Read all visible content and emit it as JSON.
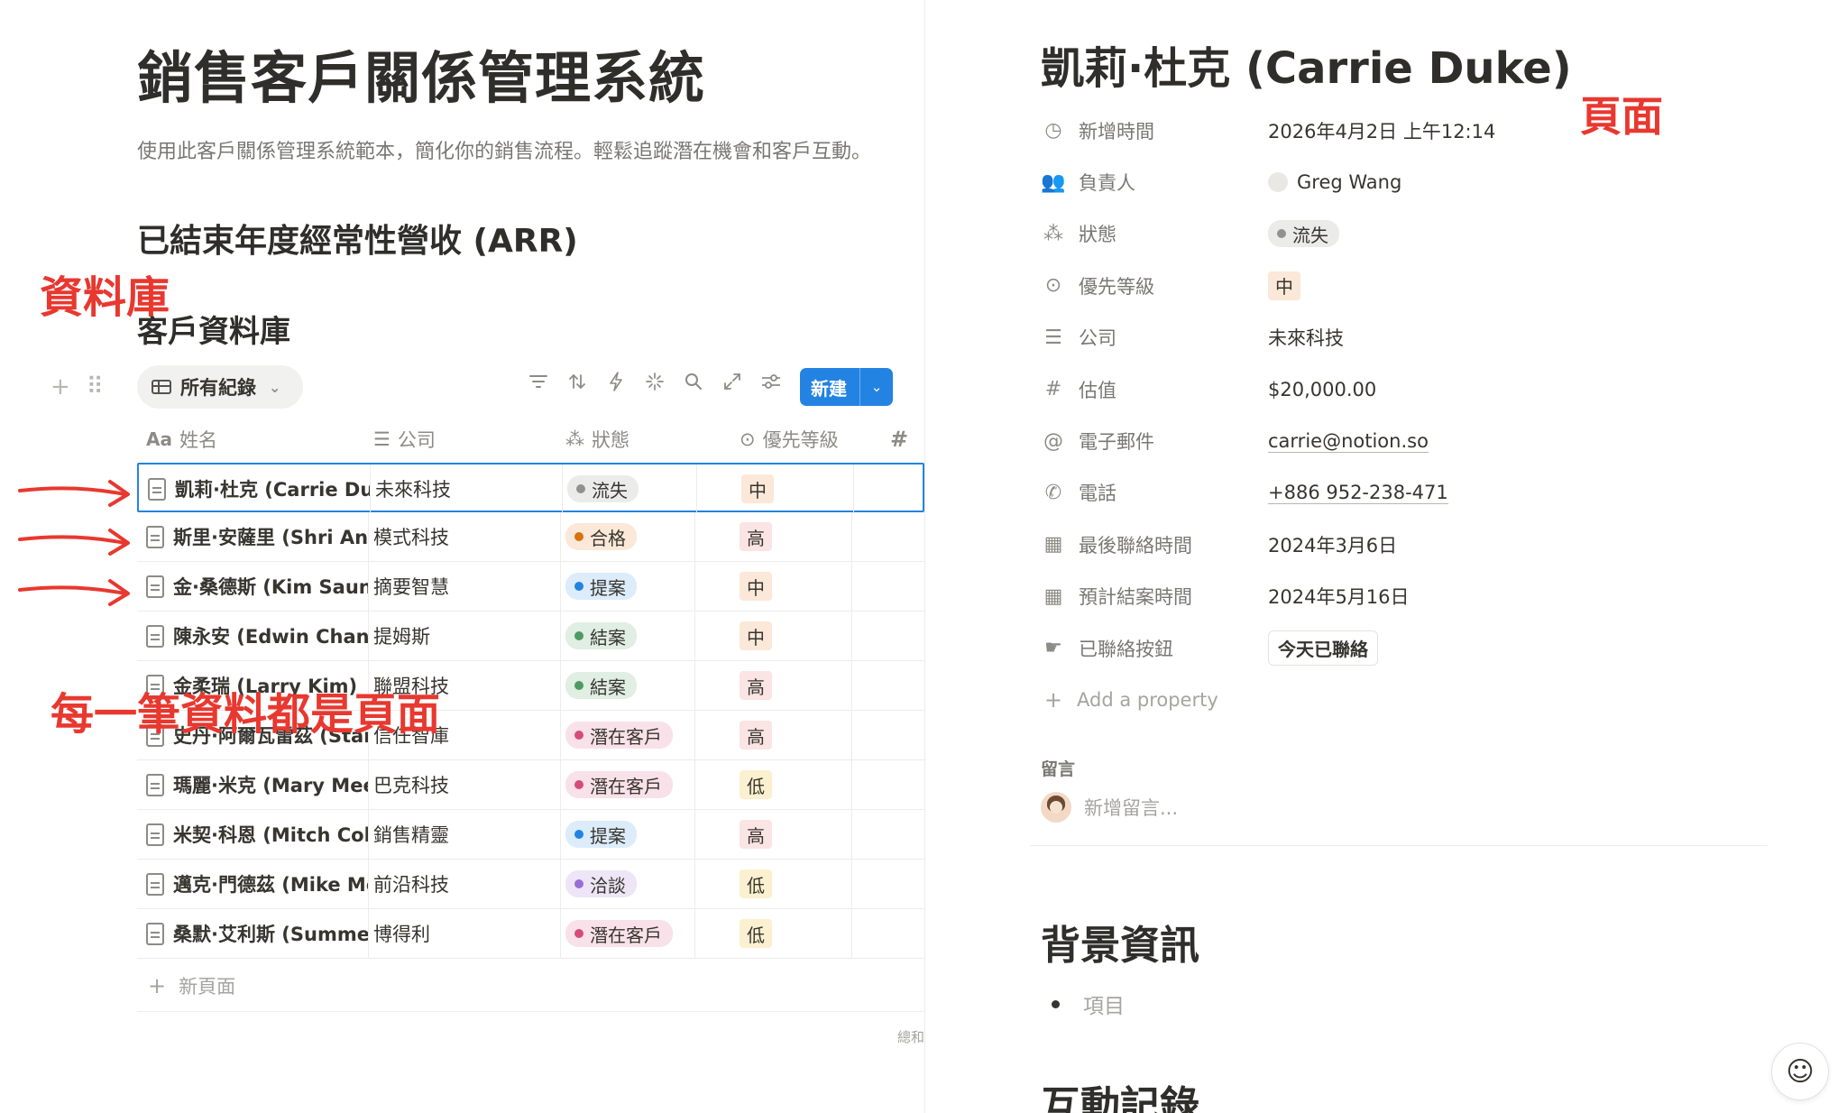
{
  "left": {
    "title": "銷售客戶關係管理系統",
    "description": "使用此客戶關係管理系統範本，簡化你的銷售流程。輕鬆追蹤潛在機會和客戶互動。",
    "heading_arr": "已結束年度經常性營收 (ARR)",
    "heading_db": "客戶資料庫",
    "view_label": "所有紀錄",
    "new_button": "新建",
    "columns": {
      "name": "姓名",
      "company": "公司",
      "status": "狀態",
      "priority": "優先等級"
    },
    "rows": [
      {
        "name": "凱莉·杜克 (Carrie Duke)",
        "company": "未來科技",
        "status": "流失",
        "priority": "中"
      },
      {
        "name": "斯里·安薩里 (Shri Ansari)",
        "company": "模式科技",
        "status": "合格",
        "priority": "高"
      },
      {
        "name": "金·桑德斯 (Kim Saunders)",
        "company": "摘要智慧",
        "status": "提案",
        "priority": "中"
      },
      {
        "name": "陳永安 (Edwin Chan)",
        "company": "提姆斯",
        "status": "結案",
        "priority": "中"
      },
      {
        "name": "金柔瑞 (Larry Kim)",
        "company": "聯盟科技",
        "status": "結案",
        "priority": "高"
      },
      {
        "name": "史丹·阿爾瓦雷茲 (Stan Alvarez)",
        "company": "信任智庫",
        "status": "潛在客戶",
        "priority": "高"
      },
      {
        "name": "瑪麗·米克 (Mary Meeker)",
        "company": "巴克科技",
        "status": "潛在客戶",
        "priority": "低"
      },
      {
        "name": "米契·科恩 (Mitch Cohen)",
        "company": "銷售精靈",
        "status": "提案",
        "priority": "高"
      },
      {
        "name": "邁克·門德茲 (Mike Mendez)",
        "company": "前沿科技",
        "status": "洽談",
        "priority": "低"
      },
      {
        "name": "桑默·艾利斯 (Summer Ellis)",
        "company": "博得利",
        "status": "潛在客戶",
        "priority": "低"
      }
    ],
    "new_page": "新頁面",
    "sum_label": "總和"
  },
  "status_colors": {
    "流失": {
      "bg": "#ebebea",
      "dot": "#91918e",
      "fg": "#37352f"
    },
    "合格": {
      "bg": "#fbe8d8",
      "dot": "#d9730d",
      "fg": "#37352f"
    },
    "提案": {
      "bg": "#dcecfa",
      "dot": "#2383e2",
      "fg": "#37352f"
    },
    "結案": {
      "bg": "#e0eee3",
      "dot": "#4f9a63",
      "fg": "#37352f"
    },
    "潛在客戶": {
      "bg": "#f9e1e9",
      "dot": "#d44c7a",
      "fg": "#37352f"
    },
    "洽談": {
      "bg": "#eee5f6",
      "dot": "#9a6dd7",
      "fg": "#37352f"
    }
  },
  "priority_colors": {
    "高": {
      "bg": "#fbe4e4",
      "fg": "#37352f"
    },
    "中": {
      "bg": "#fbe8d8",
      "fg": "#37352f"
    },
    "低": {
      "bg": "#fbf0cf",
      "fg": "#37352f"
    }
  },
  "annotations": {
    "database": "資料庫",
    "each_row": "每一筆資料都是頁面",
    "page": "頁面"
  },
  "right": {
    "title": "凱莉·杜克 (Carrie Duke)",
    "properties": [
      {
        "icon": "clock-icon",
        "key": "新增時間",
        "value": "2026年4月2日 上午12:14"
      },
      {
        "icon": "people-icon",
        "key": "負責人",
        "value": "Greg Wang"
      },
      {
        "icon": "status-icon",
        "key": "狀態",
        "value": "流失"
      },
      {
        "icon": "priority-icon",
        "key": "優先等級",
        "value": "中"
      },
      {
        "icon": "text-icon",
        "key": "公司",
        "value": "未來科技"
      },
      {
        "icon": "number-icon",
        "key": "估值",
        "value": "$20,000.00"
      },
      {
        "icon": "email-icon",
        "key": "電子郵件",
        "value": "carrie@notion.so"
      },
      {
        "icon": "phone-icon",
        "key": "電話",
        "value": "+886 952-238-471"
      },
      {
        "icon": "calendar-icon",
        "key": "最後聯絡時間",
        "value": "2024年3月6日"
      },
      {
        "icon": "calendar-icon",
        "key": "預計結案時間",
        "value": "2024年5月16日"
      },
      {
        "icon": "button-icon",
        "key": "已聯絡按鈕",
        "value": "今天已聯絡"
      }
    ],
    "add_property": "Add a property",
    "comments_heading": "留言",
    "comment_placeholder": "新增留言...",
    "section_background": "背景資訊",
    "bullet_item": "項目",
    "section_log": "互動記錄"
  }
}
